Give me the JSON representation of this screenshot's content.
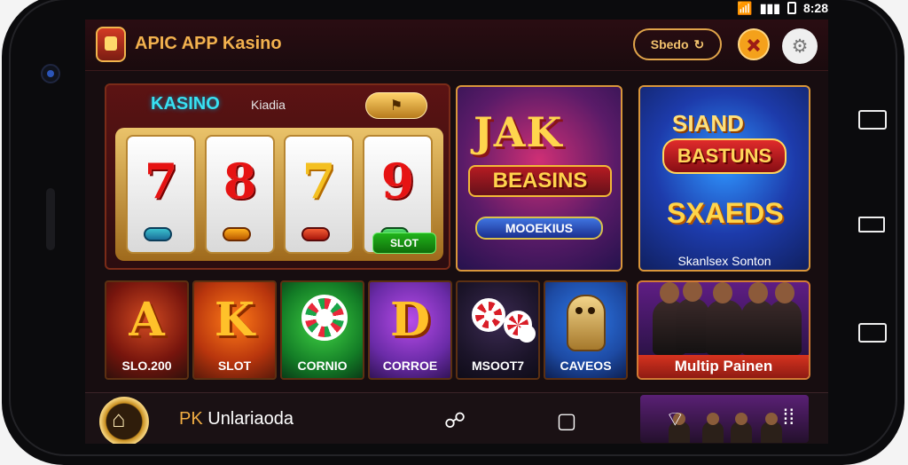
{
  "status": {
    "time": "8:28",
    "wifi_icon": "wifi-icon",
    "signal_icon": "signal-icon",
    "battery_icon": "battery-icon"
  },
  "app": {
    "title": "APIC APP Kasino",
    "coin_label": "Sbedo",
    "coin_icon": "refresh-icon"
  },
  "slot_panel": {
    "brand": "KASINO",
    "subtitle": "Kiadia",
    "pill": "⭐",
    "reels": [
      "7",
      "8",
      "7",
      "9"
    ],
    "button": "SLOT"
  },
  "promo_cards": [
    {
      "title": "JAK",
      "subtitle": "BEASINS",
      "badge": "MOOEKIUS"
    },
    {
      "title": "SIAND",
      "subtitle": "BASTUNS",
      "badge": "SXAEDS",
      "caption": "Skanlsex Sonton"
    }
  ],
  "tiles": [
    {
      "glyph": "A",
      "label": "SLO.200"
    },
    {
      "glyph": "K",
      "label": "SLOT"
    },
    {
      "glyph": "",
      "label": "CORNIO"
    },
    {
      "glyph": "D",
      "label": "CORROE"
    },
    {
      "glyph": "",
      "label": "MSOOT7"
    },
    {
      "glyph": "",
      "label": "CAVEOS"
    }
  ],
  "multi": {
    "label": "Multip Painen"
  },
  "bottom_bar": {
    "title_accent": "PK",
    "title_rest": " Unlariaoda",
    "chat_icon": "chat-icon",
    "page_icon": "page-icon",
    "promo_chat_icon": "chat-icon",
    "promo_menu_icon": "grid-icon"
  },
  "colors": {
    "accent": "#f0ad43",
    "background": "#170d10",
    "green_button": "#21b31b"
  }
}
